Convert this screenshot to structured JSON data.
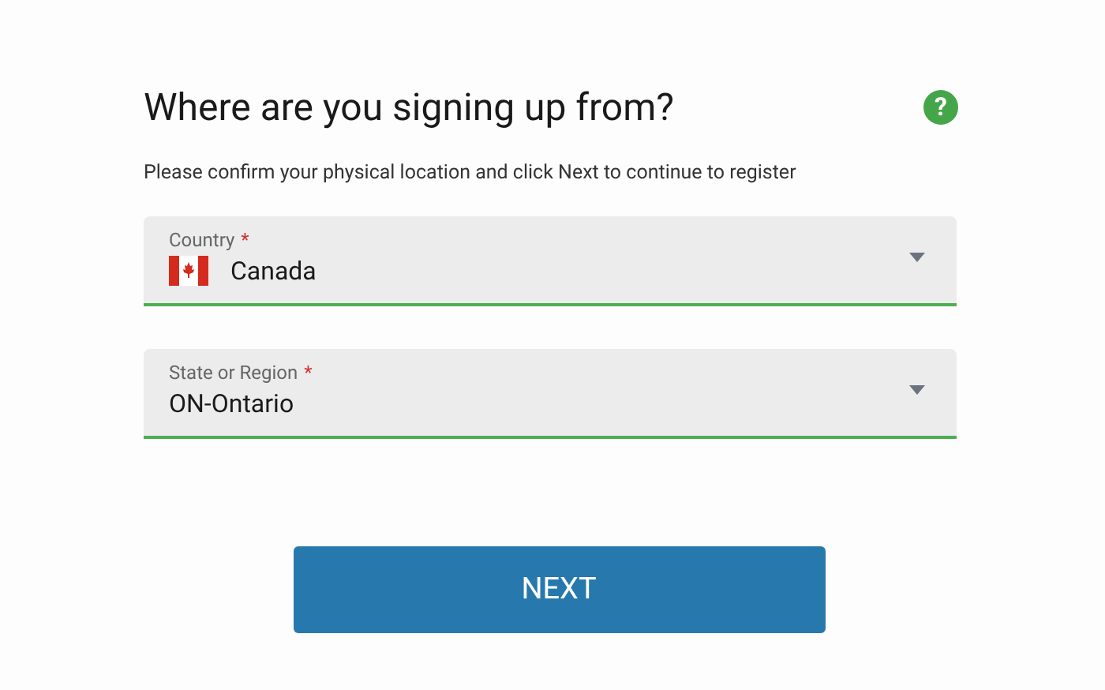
{
  "title": "Where are you signing up from?",
  "help": "?",
  "subtitle": "Please confirm your physical location and click Next to continue to register",
  "fields": [
    {
      "kind": "country",
      "label": "Country",
      "required_mark": "*",
      "value": "Canada"
    },
    {
      "kind": "plain",
      "label": "State or Region",
      "required_mark": "*",
      "value": "ON-Ontario"
    }
  ],
  "button": "NEXT"
}
